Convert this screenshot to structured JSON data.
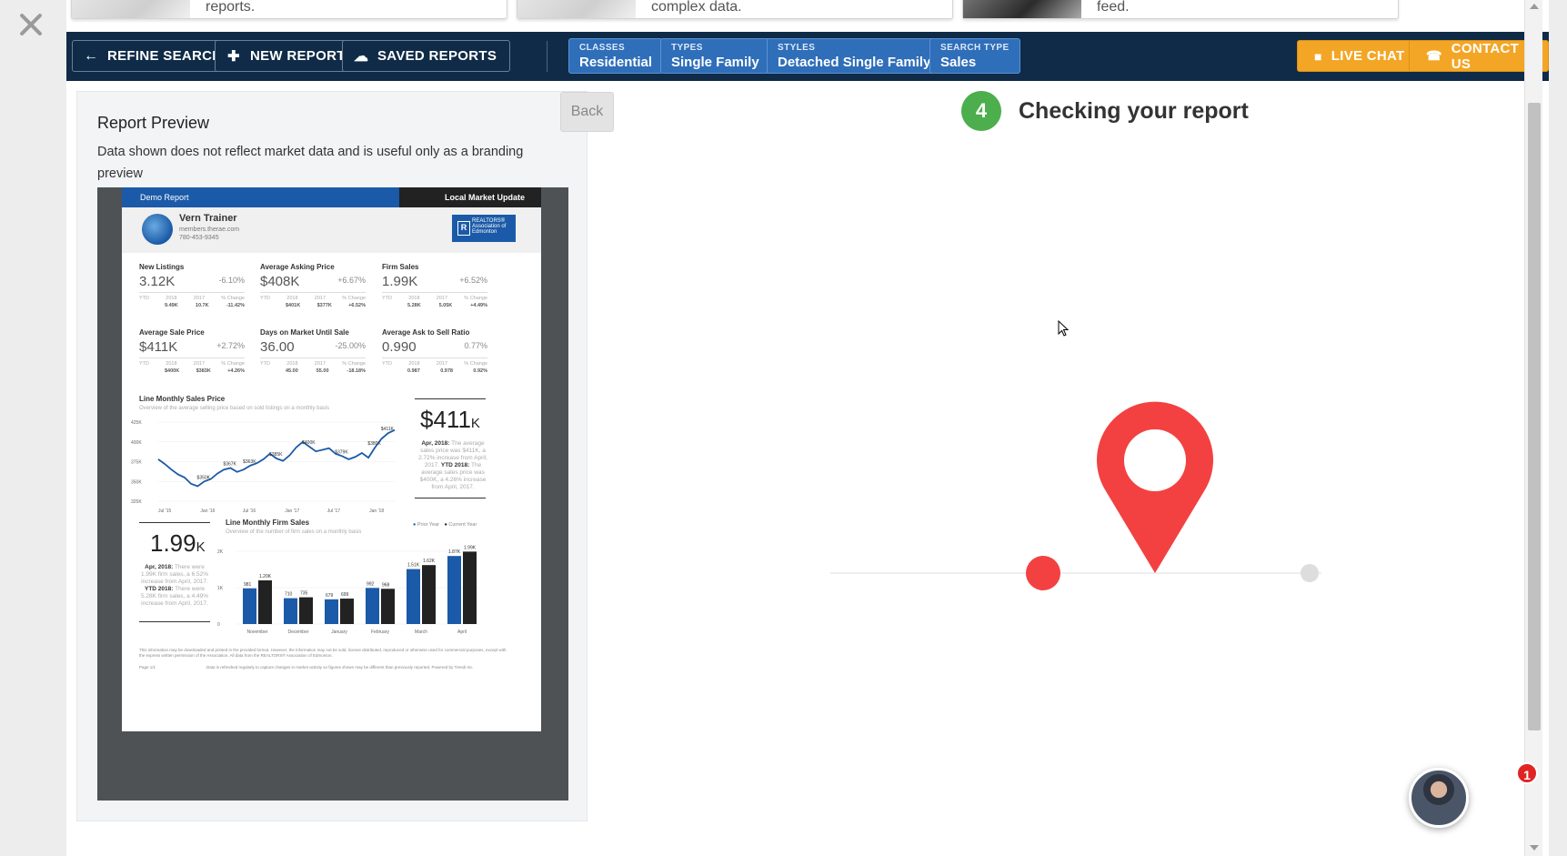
{
  "top_cards": [
    {
      "text": "reports."
    },
    {
      "text": "complex data."
    },
    {
      "text": "feed."
    }
  ],
  "toolbar": {
    "refine_search": "REFINE SEARCH",
    "new_report": "NEW REPORT",
    "saved_reports": "SAVED REPORTS",
    "live_chat": "LIVE CHAT",
    "contact_us": "CONTACT US"
  },
  "filters": [
    {
      "key": "CLASSES",
      "value": "Residential"
    },
    {
      "key": "TYPES",
      "value": "Single Family"
    },
    {
      "key": "STYLES",
      "value": "Detached Single Family"
    },
    {
      "key": "SEARCH TYPE",
      "value": "Sales"
    }
  ],
  "preview": {
    "title": "Report Preview",
    "description": "Data shown does not reflect market data and is useful only as a branding preview"
  },
  "report": {
    "demo_label": "Demo Report",
    "header_title": "Local Market Update",
    "agent_name": "Vern Trainer",
    "agent_site": "members.therae.com",
    "agent_phone": "780-453-9345",
    "board_logo": "REALTORS® Association of Edmonton",
    "stats": [
      {
        "title": "New Listings",
        "value": "3.12K",
        "pct": "-6.10%",
        "ytd": [
          "9.49K",
          "10.7K",
          "-11.42%"
        ]
      },
      {
        "title": "Average Asking Price",
        "value": "$408K",
        "pct": "+6.67%",
        "ytd": [
          "$401K",
          "$377K",
          "+6.52%"
        ]
      },
      {
        "title": "Firm Sales",
        "value": "1.99K",
        "pct": "+6.52%",
        "ytd": [
          "5.28K",
          "5.05K",
          "+4.49%"
        ]
      },
      {
        "title": "Average Sale Price",
        "value": "$411K",
        "pct": "+2.72%",
        "ytd": [
          "$400K",
          "$383K",
          "+4.26%"
        ]
      },
      {
        "title": "Days on Market Until Sale",
        "value": "36.00",
        "pct": "-25.00%",
        "ytd": [
          "45.00",
          "55.00",
          "-18.18%"
        ]
      },
      {
        "title": "Average Ask to Sell Ratio",
        "value": "0.990",
        "pct": "0.77%",
        "ytd": [
          "0.987",
          "0.978",
          "0.92%"
        ]
      }
    ],
    "ytd_labels": [
      "YTD",
      "2018",
      "2017",
      "% Change"
    ],
    "line_chart": {
      "title": "Line Monthly Sales Price",
      "subtitle": "Overview of the average selling price based on sold listings on a monthly basis",
      "big_value": "$411",
      "big_suffix": "K",
      "note_date": "Apr, 2018:",
      "note_text": "The average sales price was $411K, a 2.72% increase from April, 2017.",
      "note_ytd": "YTD 2018:",
      "note_ytd_text": "The average sales price was $400K, a 4.26% increase from April, 2017."
    },
    "bar_chart": {
      "title": "Line Monthly Firm Sales",
      "subtitle": "Overview of the number of firm sales on a monthly basis",
      "big_value": "1.99",
      "big_suffix": "K",
      "note_date": "Apr, 2018:",
      "note_text": "There were 1.99K firm sales, a 6.52% increase from April, 2017.",
      "note_ytd": "YTD 2018:",
      "note_ytd_text": "There were 5.28K firm sales, a 4.49% increase from April, 2017.",
      "legend_prior": "Prior Year",
      "legend_current": "Current Year"
    },
    "footer_text": "This information may be downloaded and printed in the provided format. However, the information may not be sold, license distributed, reproduced or otherwise used for commercial purposes, except with the express written permission of the Association. All data from the REALTORS® Association of Edmonton.",
    "page_label": "Page 1/1",
    "footer_right": "Data is refreshed regularly to capture changes in market activity so figures shown may be different than previously reported. Powered by Trendi Inc."
  },
  "chart_data": [
    {
      "type": "line",
      "title": "Line Monthly Sales Price",
      "x_ticks": [
        "Jul '15",
        "Jan '16",
        "Jul '16",
        "Jan '17",
        "Jul '17",
        "Jan '18"
      ],
      "y_ticks": [
        "325K",
        "350K",
        "375K",
        "400K",
        "425K"
      ],
      "ylim": [
        325,
        425
      ],
      "series": [
        {
          "values": [
            378,
            372,
            365,
            359,
            355,
            347,
            344,
            350,
            353,
            360,
            365,
            367,
            362,
            365,
            370,
            373,
            378,
            385,
            379,
            376,
            383,
            393,
            400,
            394,
            388,
            390,
            392,
            385,
            382,
            378,
            381,
            386,
            380,
            393,
            404,
            411,
            415
          ]
        }
      ],
      "point_labels": [
        {
          "i": 7,
          "text": "$350K"
        },
        {
          "i": 11,
          "text": "$367K"
        },
        {
          "i": 14,
          "text": "$363K"
        },
        {
          "i": 18,
          "text": "$385K"
        },
        {
          "i": 23,
          "text": "$400K"
        },
        {
          "i": 28,
          "text": "$379K"
        },
        {
          "i": 33,
          "text": "$380K"
        },
        {
          "i": 35,
          "text": "$411K"
        }
      ]
    },
    {
      "type": "bar",
      "title": "Line Monthly Firm Sales",
      "categories": [
        "November",
        "December",
        "January",
        "February",
        "March",
        "April"
      ],
      "y_ticks": [
        "0",
        "1K",
        "2K"
      ],
      "ylim": [
        0,
        2
      ],
      "series": [
        {
          "name": "Prior Year",
          "values": [
            0.981,
            0.71,
            0.679,
            0.992,
            1.51,
            1.87
          ],
          "labels": [
            "981",
            "710",
            "679",
            "992",
            "1.51K",
            "1.87K"
          ]
        },
        {
          "name": "Current Year",
          "values": [
            1.2,
            0.735,
            0.699,
            0.968,
            1.62,
            1.99
          ],
          "labels": [
            "1.20K",
            "735",
            "699",
            "968",
            "1.62K",
            "1.99K"
          ]
        }
      ],
      "colors": {
        "prior": "#1b5aa8",
        "current": "#222222"
      }
    }
  ],
  "wizard": {
    "back_label": "Back",
    "step_number": "4",
    "step_title": "Checking your report"
  },
  "chat_widget": {
    "badge": "1"
  },
  "colors": {
    "nav": "#0f2b47",
    "chip": "#2f6eb8",
    "orange": "#f3a626",
    "green": "#4cae4c",
    "pin": "#f34141"
  }
}
